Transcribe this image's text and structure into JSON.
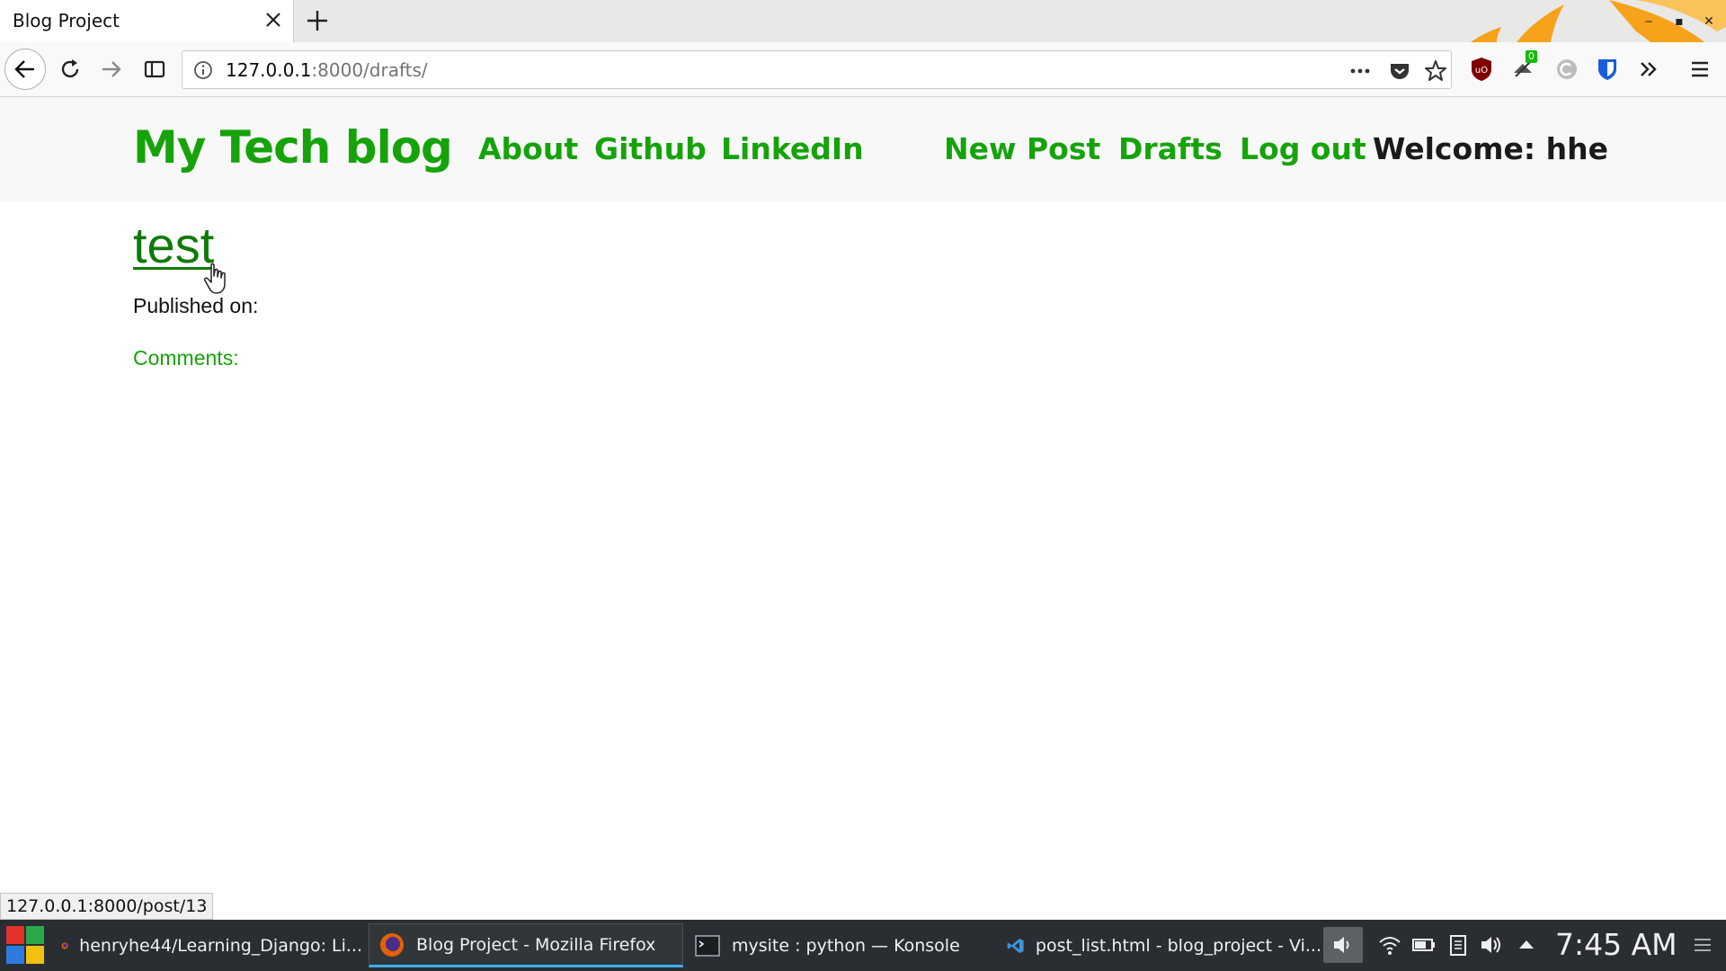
{
  "browser": {
    "tab_title": "Blog Project",
    "url_host": "127.0.0.1",
    "url_rest": ":8000/drafts/",
    "extension_badge": "0",
    "status_url": "127.0.0.1:8000/post/13"
  },
  "site": {
    "brand": "My Tech blog",
    "nav_left": [
      "About",
      "Github",
      "LinkedIn"
    ],
    "nav_right": [
      "New Post",
      "Drafts",
      "Log out"
    ],
    "welcome": "Welcome: hhe"
  },
  "post": {
    "title": "test",
    "published_label": "Published on:",
    "comments_label": "Comments:"
  },
  "taskbar": {
    "tasks": [
      "henryhe44/Learning_Django: Li...",
      "Blog Project - Mozilla Firefox",
      "mysite : python — Konsole",
      "post_list.html - blog_project - Vi..."
    ],
    "clock": "7:45 AM"
  },
  "colors": {
    "site_green": "#16a30a",
    "title_green": "#0f7a0a",
    "taskbar": "#2a2e32"
  }
}
